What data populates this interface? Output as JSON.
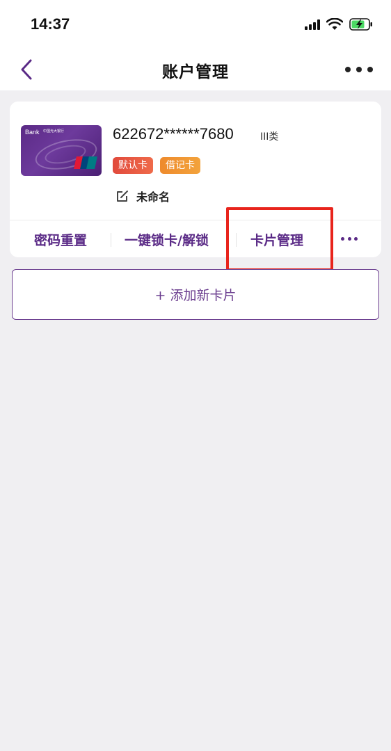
{
  "status_bar": {
    "time": "14:37",
    "icons": [
      "signal-icon",
      "wifi-icon",
      "battery-charging-icon"
    ]
  },
  "nav": {
    "title": "账户管理",
    "back_icon": "chevron-left-icon",
    "more_icon": "more-dots-icon"
  },
  "card": {
    "brand": "Bank",
    "brand_cn": "中国光大银行",
    "number": "622672******7680",
    "class_label": "III类",
    "tags": {
      "default": "默认卡",
      "debit": "借记卡"
    },
    "name_label": "未命名",
    "edit_icon": "edit-icon"
  },
  "actions": {
    "reset_password": "密码重置",
    "lock_unlock": "一键锁卡/解锁",
    "card_management": "卡片管理",
    "more_icon": "more-dots-icon"
  },
  "add_card": {
    "label": "+ 添加新卡片"
  },
  "colors": {
    "accent": "#5a2a86",
    "highlight": "#e8241c",
    "tag_default": "#e14a3c",
    "tag_debit": "#ee8a2c",
    "background": "#f0eff2"
  }
}
